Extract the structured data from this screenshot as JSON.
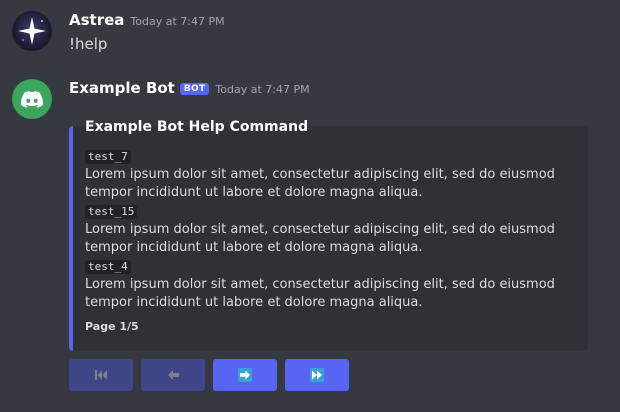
{
  "messages": [
    {
      "username": "Astrea",
      "timestamp": "Today at 7:47 PM",
      "content": "!help"
    },
    {
      "username": "Example Bot",
      "bot_badge": "BOT",
      "timestamp": "Today at 7:47 PM",
      "embed": {
        "title": "Example Bot Help Command",
        "fields": [
          {
            "name": "test_7",
            "value": "Lorem ipsum dolor sit amet, consectetur adipiscing elit, sed do eiusmod tempor incididunt ut labore et dolore magna aliqua."
          },
          {
            "name": "test_15",
            "value": "Lorem ipsum dolor sit amet, consectetur adipiscing elit, sed do eiusmod tempor incididunt ut labore et dolore magna aliqua."
          },
          {
            "name": "test_4",
            "value": "Lorem ipsum dolor sit amet, consectetur adipiscing elit, sed do eiusmod tempor incididunt ut labore et dolore magna aliqua."
          }
        ],
        "footer": "Page 1/5",
        "accent_color": "#5865f2"
      },
      "buttons": [
        {
          "icon": "first-page-icon",
          "state": "disabled"
        },
        {
          "icon": "previous-page-icon",
          "state": "disabled"
        },
        {
          "icon": "next-page-icon",
          "state": "enabled"
        },
        {
          "icon": "last-page-icon",
          "state": "enabled"
        }
      ]
    }
  ]
}
